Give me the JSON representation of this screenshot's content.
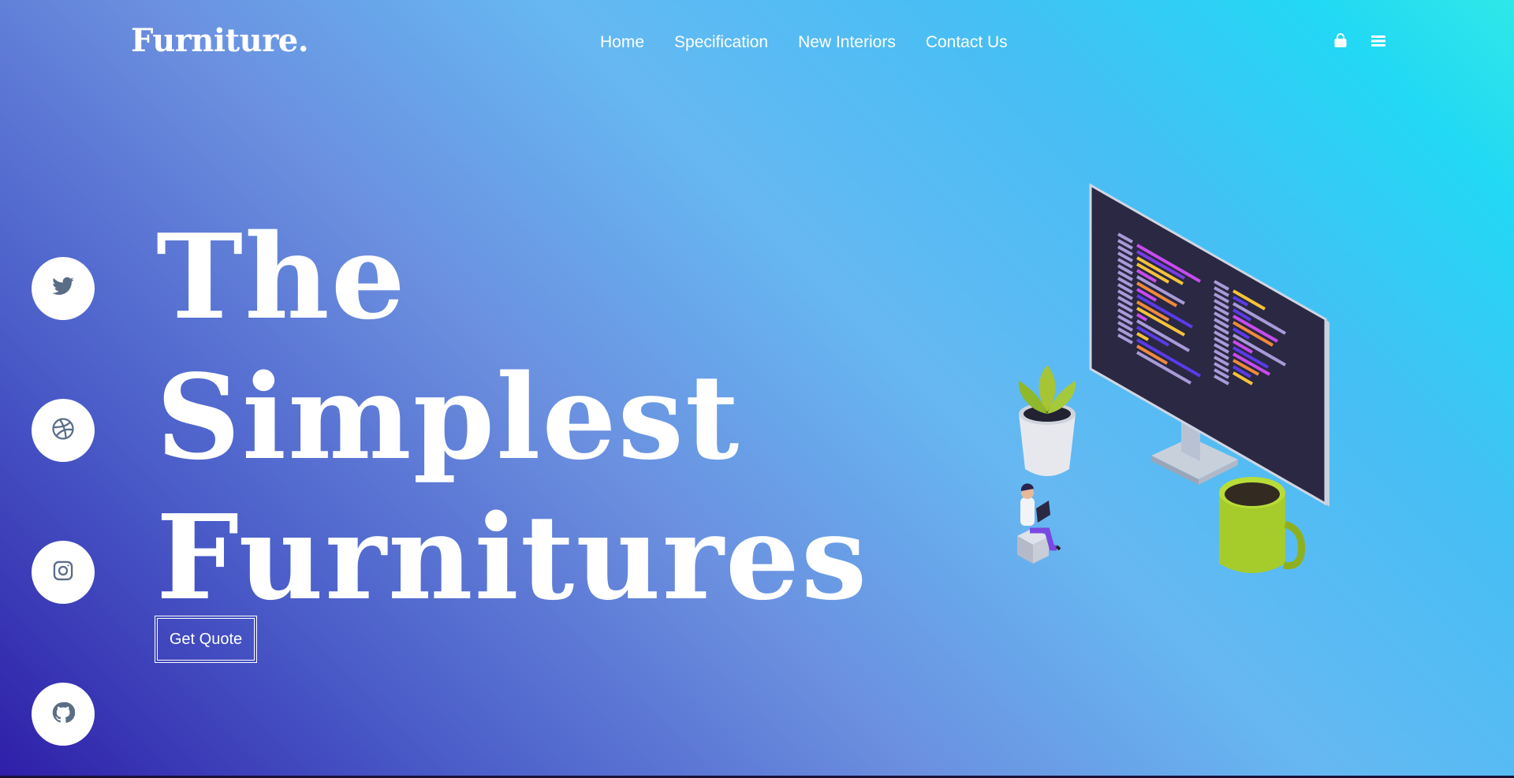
{
  "header": {
    "logo": "Furniture.",
    "nav": [
      {
        "label": "Home"
      },
      {
        "label": "Specification"
      },
      {
        "label": "New Interiors"
      },
      {
        "label": "Contact Us"
      }
    ],
    "icons": [
      "shopping-bag-icon",
      "menu-icon"
    ]
  },
  "social": [
    "twitter-icon",
    "dribbble-icon",
    "instagram-icon",
    "github-icon"
  ],
  "hero": {
    "line1": "The",
    "line2": "Simplest",
    "line3": "Furnitures",
    "button": "Get Quote"
  },
  "colors": {
    "gradient_top_right": "#2ee8e8",
    "gradient_mid": "#66b8f2",
    "gradient_bottom_left": "#2e1fa8",
    "social_icon": "#5a6d87"
  }
}
